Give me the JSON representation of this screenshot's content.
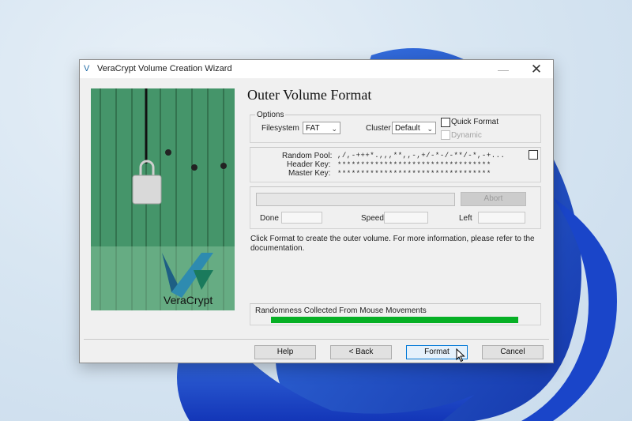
{
  "window": {
    "title": "VeraCrypt Volume Creation Wizard",
    "minimize_glyph": "—",
    "close_glyph": "✕"
  },
  "page": {
    "title": "Outer Volume Format"
  },
  "options": {
    "legend": "Options",
    "filesystem_label": "Filesystem",
    "filesystem_value": "FAT",
    "cluster_label": "Cluster",
    "cluster_value": "Default",
    "quick_format_label": "Quick Format",
    "quick_format_checked": false,
    "dynamic_label": "Dynamic",
    "dynamic_checked": false
  },
  "keys": {
    "random_pool_label": "Random Pool:",
    "random_pool_value": ",/,-+++*.,,,**,,-,+/-*-/-**/-*,-+...",
    "header_key_label": "Header Key:",
    "header_key_value": "*********************************",
    "master_key_label": "Master Key:",
    "master_key_value": "*********************************",
    "show_checked": false
  },
  "progress": {
    "abort_label": "Abort",
    "done_label": "Done",
    "speed_label": "Speed",
    "left_label": "Left",
    "done_value": "",
    "speed_value": "",
    "left_value": ""
  },
  "info_text": "Click Format to create the outer volume. For more information, please refer to the documentation.",
  "randomness": {
    "label": "Randomness Collected From Mouse Movements",
    "fill_fraction": 1.0
  },
  "buttons": {
    "help": "Help",
    "back": "< Back",
    "format": "Format",
    "cancel": "Cancel"
  },
  "logo": {
    "text": "VeraCrypt"
  },
  "colors": {
    "progress_green": "#06b025",
    "default_button_border": "#0078d7",
    "door_green": "#3c8c63"
  }
}
